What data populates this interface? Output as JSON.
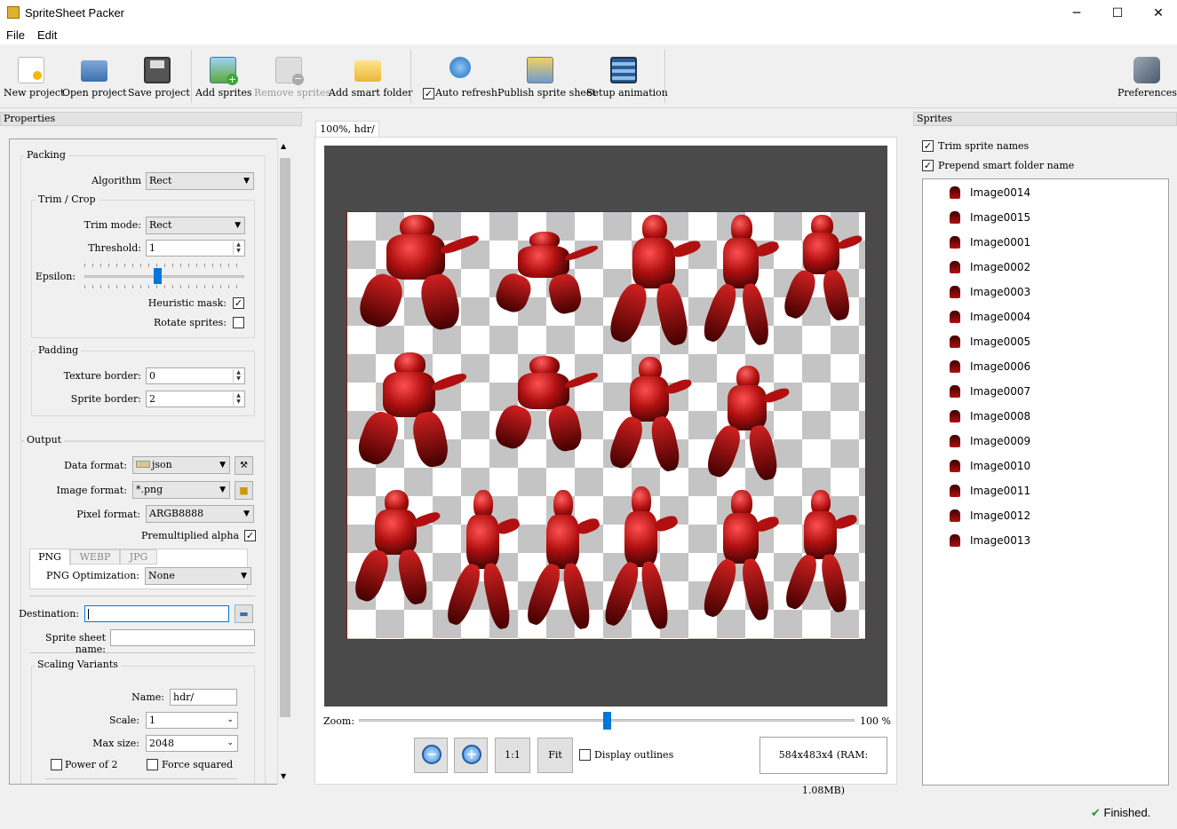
{
  "window": {
    "title": "SpriteSheet Packer",
    "minimize": "─",
    "maximize": "☐",
    "close": "✕"
  },
  "menu": [
    "File",
    "Edit"
  ],
  "toolbar": {
    "new_project": "New project",
    "open_project": "Open project",
    "save_project": "Save project",
    "add_sprites": "Add sprites",
    "remove_sprites": "Remove sprites",
    "add_smart_folder": "Add smart folder",
    "auto_refresh": "Auto refresh",
    "auto_refresh_checked": true,
    "publish": "Publish sprite sheet",
    "setup_animation": "Setup animation",
    "preferences": "Preferences"
  },
  "properties": {
    "header": "Properties",
    "packing": {
      "title": "Packing",
      "algorithm_label": "Algorithm",
      "algorithm": "Rect",
      "trim_title": "Trim / Crop",
      "trim_mode_label": "Trim mode:",
      "trim_mode": "Rect",
      "threshold_label": "Threshold:",
      "threshold": "1",
      "epsilon_label": "Epsilon:",
      "heuristic_label": "Heuristic mask:",
      "heuristic": true,
      "rotate_label": "Rotate sprites:",
      "rotate": false,
      "padding_title": "Padding",
      "texture_border_label": "Texture border:",
      "texture_border": "0",
      "sprite_border_label": "Sprite border:",
      "sprite_border": "2"
    },
    "output": {
      "title": "Output",
      "data_format_label": "Data format:",
      "data_format": "json",
      "image_format_label": "Image format:",
      "image_format": "*.png",
      "pixel_format_label": "Pixel format:",
      "pixel_format": "ARGB8888",
      "premultiplied_label": "Premultiplied alpha",
      "premultiplied": true,
      "tabs": [
        "PNG",
        "WEBP",
        "JPG"
      ],
      "png_opt_label": "PNG Optimization:",
      "png_opt": "None",
      "destination_label": "Destination:",
      "destination": "",
      "sheet_name_label": "Sprite sheet name:",
      "sheet_name": ""
    },
    "scaling": {
      "title": "Scaling Variants",
      "name_label": "Name:",
      "name": "hdr/",
      "scale_label": "Scale:",
      "scale": "1",
      "max_size_label": "Max size:",
      "max_size": "2048",
      "power_of_2_label": "Power of 2",
      "power_of_2": false,
      "force_squared_label": "Force squared",
      "force_squared": false
    }
  },
  "viewer": {
    "tab": "100%, hdr/",
    "zoom_label": "Zoom:",
    "zoom_value": "100 %",
    "zoom_level": 0.5,
    "one_to_one": "1:1",
    "fit": "Fit",
    "display_outlines_label": "Display outlines",
    "display_outlines": false,
    "info": "584x483x4 (RAM: 1.08MB)"
  },
  "sprites": {
    "header": "Sprites",
    "trim_names_label": "Trim sprite names",
    "trim_names": true,
    "prepend_label": "Prepend smart folder name",
    "prepend": true,
    "items": [
      "Image0014",
      "Image0015",
      "Image0001",
      "Image0002",
      "Image0003",
      "Image0004",
      "Image0005",
      "Image0006",
      "Image0007",
      "Image0008",
      "Image0009",
      "Image0010",
      "Image0011",
      "Image0012",
      "Image0013"
    ]
  },
  "status": {
    "text": "Finished.",
    "icon": "check-icon"
  },
  "colors": {
    "sprite_red": "#b01010",
    "accent": "#0078d7",
    "canvas": "#4a4a4a"
  }
}
